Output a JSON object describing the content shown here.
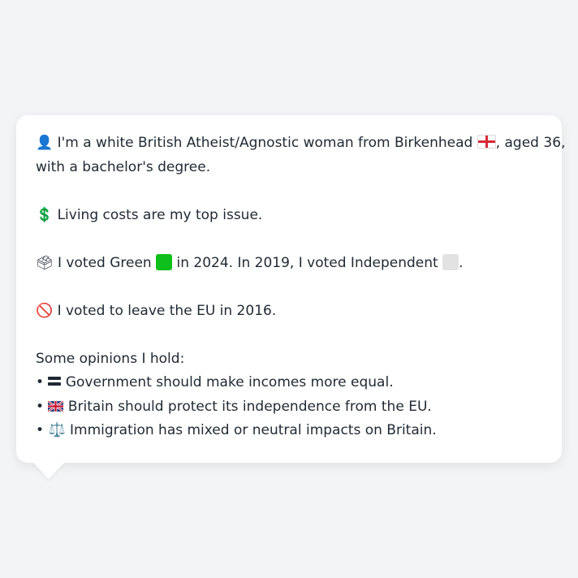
{
  "bubble": {
    "intro_line1": "I'm a white British Atheist/Agnostic woman from Birkenhead",
    "intro_line1_suffix": ", aged 36,",
    "intro_line2": "with a bachelor's degree.",
    "issue": "Living costs are my top issue.",
    "vote_a": "I voted Green",
    "vote_b": "in 2024. In 2019, I voted Independent",
    "vote_c": ".",
    "brexit": "I voted to leave the EU in 2016.",
    "opinions_header": "Some opinions I hold:",
    "opinions": [
      "Government should make incomes more equal.",
      "Britain should protect its independence from the EU.",
      "Immigration has mixed or neutral impacts on Britain."
    ],
    "bullet": "•"
  },
  "icons": {
    "person": "👤",
    "england_flag": "england-flag-icon",
    "dollar": "💲",
    "ballot": "🗳",
    "green_square": "green-square-icon",
    "grey_square": "grey-square-icon",
    "prohibited": "🚫",
    "equals": "equals-icon",
    "uk_flag": "uk-flag-icon",
    "scales": "⚖️"
  },
  "colors": {
    "background": "#f3f4f6",
    "bubble": "#ffffff",
    "text": "#1f2933",
    "green": "#0fbf1b",
    "grey": "#e2e2e2",
    "red": "#d62a36"
  }
}
